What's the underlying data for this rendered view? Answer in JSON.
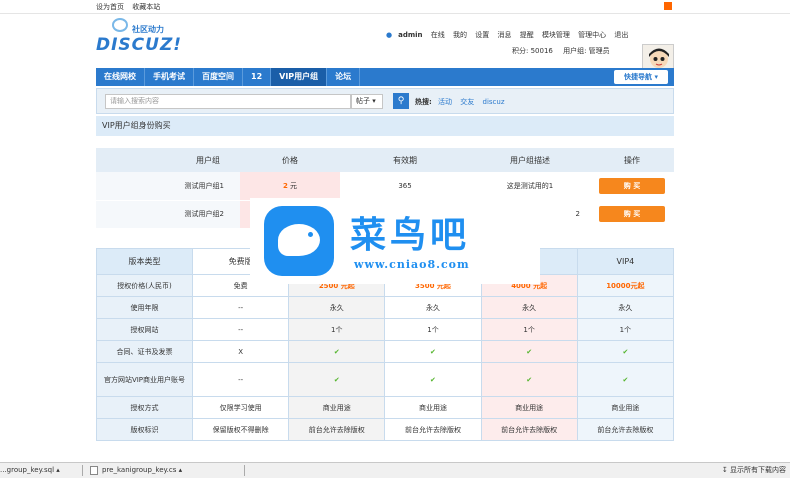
{
  "topbar": {
    "set_home": "设为首页",
    "bookmark": "收藏本站"
  },
  "logo": {
    "top": "社区动力",
    "main": "DISCUZ!"
  },
  "user": {
    "name": "admin",
    "online": "在线",
    "menu": [
      "我的",
      "设置",
      "消息",
      "提醒",
      "模块管理",
      "管理中心",
      "退出"
    ],
    "credits": "积分: 50016",
    "group": "用户组: 管理员"
  },
  "nav": {
    "items": [
      "在线网校",
      "手机考试",
      "百度空间",
      "12",
      "VIP用户组",
      "论坛"
    ],
    "active": 4,
    "quick": "快捷导航"
  },
  "search": {
    "placeholder": "请输入搜索内容",
    "type": "帖子",
    "hot_label": "热搜:",
    "hot": [
      "活动",
      "交友",
      "discuz"
    ]
  },
  "page_title": "VIP用户组身份购买",
  "groups_table": {
    "headers": [
      "用户组",
      "价格",
      "有效期",
      "用户组描述",
      "操作"
    ],
    "rows": [
      {
        "name": "测试用户组1",
        "price": "2",
        "unit": "元",
        "validity": "365",
        "desc": "这是测试用的1",
        "action": "购 买"
      },
      {
        "name": "测试用户组2",
        "price": "",
        "unit": "",
        "validity": "",
        "desc": "2",
        "action": "购 买"
      }
    ]
  },
  "versions_table": {
    "headers": [
      "版本类型",
      "免费版",
      "",
      "",
      "",
      "VIP4"
    ],
    "rows": [
      {
        "label": "授权价格(人民币)",
        "cells": [
          "免费",
          "2500 元起",
          "3500 元起",
          "4000 元起",
          "10000元起"
        ]
      },
      {
        "label": "使用年限",
        "cells": [
          "--",
          "永久",
          "永久",
          "永久",
          "永久"
        ]
      },
      {
        "label": "授权网站",
        "cells": [
          "--",
          "1个",
          "1个",
          "1个",
          "1个"
        ]
      },
      {
        "label": "合同、证书及发票",
        "cells": [
          "X",
          "✔",
          "✔",
          "✔",
          "✔"
        ]
      },
      {
        "label": "官方网站VIP商业用户账号",
        "cells": [
          "--",
          "✔",
          "✔",
          "✔",
          "✔"
        ]
      },
      {
        "label": "授权方式",
        "cells": [
          "仅限学习使用",
          "商业用途",
          "商业用途",
          "商业用途",
          "商业用途"
        ]
      },
      {
        "label": "版权标识",
        "cells": [
          "保留版权不得删除",
          "前台允许去除版权",
          "前台允许去除版权",
          "前台允许去除版权",
          "前台允许去除版权"
        ]
      }
    ]
  },
  "watermark": {
    "title": "菜鸟吧",
    "url": "www.cniao8.com"
  },
  "downloads": {
    "items": [
      "...group_key.sql",
      "pre_kanigroup_key.cs"
    ],
    "show_all": "显示所有下载内容"
  }
}
